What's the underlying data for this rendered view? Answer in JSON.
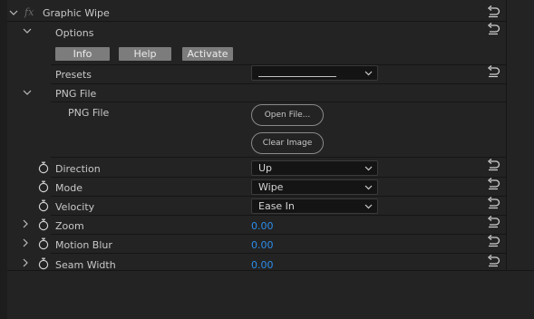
{
  "effect": {
    "fx_label": "fx",
    "title": "Graphic Wipe"
  },
  "options": {
    "label": "Options",
    "buttons": {
      "info": "Info",
      "help": "Help",
      "activate": "Activate"
    }
  },
  "presets": {
    "label": "Presets",
    "value": ""
  },
  "png_file": {
    "group_label": "PNG File",
    "label": "PNG File",
    "open_button": "Open File...",
    "clear_button": "Clear Image"
  },
  "params": {
    "direction": {
      "label": "Direction",
      "value": "Up"
    },
    "mode": {
      "label": "Mode",
      "value": "Wipe"
    },
    "velocity": {
      "label": "Velocity",
      "value": "Ease In"
    },
    "zoom": {
      "label": "Zoom",
      "value": "0.00"
    },
    "motion_blur": {
      "label": "Motion Blur",
      "value": "0.00"
    },
    "seam_width": {
      "label": "Seam Width",
      "value": "0.00"
    }
  },
  "icons": {
    "expand": "chevron-down-icon",
    "collapse": "chevron-right-icon",
    "reset": "reset-icon",
    "stopwatch": "stopwatch-icon"
  },
  "colors": {
    "value_blue": "#2d8ceb",
    "button_gray": "#7c7c7c",
    "background": "#232323"
  }
}
